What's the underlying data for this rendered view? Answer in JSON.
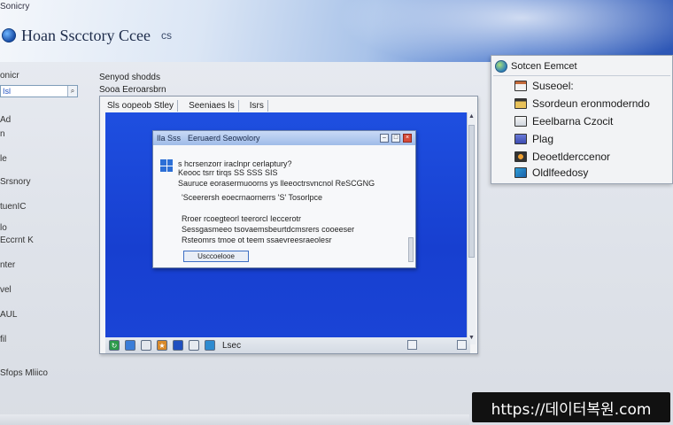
{
  "header": {
    "top_left_text": "Sonicry",
    "app_title": "Hoan Sscctory Ccee",
    "title_suffix": "cs"
  },
  "sidebar": {
    "search_value": "Isl",
    "search_button": "⌕",
    "items": [
      {
        "label": "onicr"
      },
      {
        "label": "Ad"
      },
      {
        "label": "n"
      },
      {
        "label": "le"
      },
      {
        "label": "Srsnory"
      },
      {
        "label": "tuenIC"
      },
      {
        "label": "lo"
      },
      {
        "label": "Eccrnt K"
      },
      {
        "label": "nter"
      },
      {
        "label": "vel"
      },
      {
        "label": "AUL"
      },
      {
        "label": "fil"
      },
      {
        "label": "Sfops Mliico"
      }
    ]
  },
  "main_window": {
    "label_1": "Senyod shodds",
    "label_2": "Sooa Eeroarsbrn",
    "tabs": [
      {
        "label": "Sls oopeob Stley"
      },
      {
        "label": "Seeniaes  ls"
      },
      {
        "label": "Isrs"
      }
    ]
  },
  "dialog": {
    "title_left": "Ila  Sss",
    "title_right": "Eeruaerd Seowolory",
    "lines": [
      "s hcrsenzorr iraclnpr cerlaptury?",
      "Keooc tsrr tirqs SS SSS SIS",
      "Sauruce eorasermuoorns ys lleeoctrsvncnol ReSCGNG",
      "'Sceerersh eoecrnaornerrs 'S' Tosorlpce",
      "Rroer rcoegteorl teerorcl Ieccerotr",
      "Sessgasmeeo tsovaemsbeurtdcmsrers cooeeser",
      "Rsteomrs tmoe ot teem ssaevreesraeolesr"
    ],
    "ok_label": "Usccoelooe"
  },
  "taskbar": {
    "label": "Lsec"
  },
  "context_menu": {
    "title": "Sotcen Eemcet",
    "items": [
      {
        "label": "Suseoel:"
      },
      {
        "label": "Ssordeun eronmoderndo"
      },
      {
        "label": "Eeelbarna Czocit"
      },
      {
        "label": "Plag"
      },
      {
        "label": "Deoetlderccenor"
      },
      {
        "label": "Oldlfeedosy"
      }
    ]
  },
  "watermark": {
    "text": "https://데이터복원.com"
  },
  "colors": {
    "desktop_blue": "#1e4fe0",
    "accent": "#3d6fc4"
  }
}
